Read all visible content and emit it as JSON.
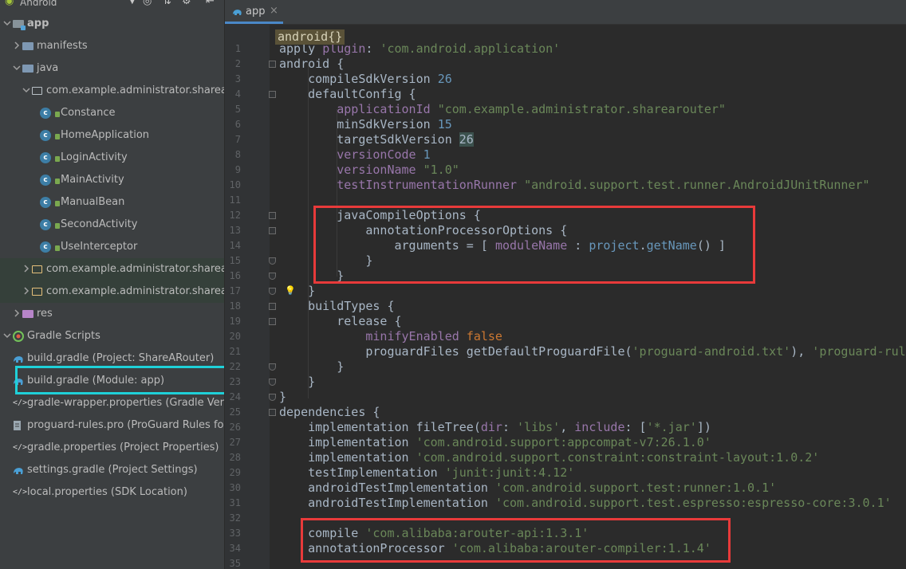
{
  "project_panel": {
    "view_selector": "Android",
    "tree": [
      {
        "label": "app",
        "depth": 0,
        "icon": "module-folder-icon",
        "expanded": true,
        "bold": true
      },
      {
        "label": "manifests",
        "depth": 1,
        "icon": "folder-icon",
        "expanded": false
      },
      {
        "label": "java",
        "depth": 1,
        "icon": "folder-icon",
        "expanded": true
      },
      {
        "label": "com.example.administrator.sharearouter",
        "depth": 2,
        "icon": "package-icon",
        "expanded": true
      },
      {
        "label": "Constance",
        "depth": 3,
        "icon": "class-icon"
      },
      {
        "label": "HomeApplication",
        "depth": 3,
        "icon": "class-icon"
      },
      {
        "label": "LoginActivity",
        "depth": 3,
        "icon": "class-icon"
      },
      {
        "label": "MainActivity",
        "depth": 3,
        "icon": "class-icon"
      },
      {
        "label": "ManualBean",
        "depth": 3,
        "icon": "class-icon"
      },
      {
        "label": "SecondActivity",
        "depth": 3,
        "icon": "class-icon"
      },
      {
        "label": "UseInterceptor",
        "depth": 3,
        "icon": "class-icon"
      },
      {
        "label": "com.example.administrator.sharearouter",
        "depth": 2,
        "icon": "test-package-icon",
        "expanded": false,
        "highlight": true
      },
      {
        "label": "com.example.administrator.sharearouter",
        "depth": 2,
        "icon": "test-package-icon",
        "expanded": false,
        "highlight": true
      },
      {
        "label": "res",
        "depth": 1,
        "icon": "res-folder-icon",
        "expanded": false
      },
      {
        "label": "Gradle Scripts",
        "depth": 0,
        "icon": "gradle-icon",
        "expanded": true
      },
      {
        "label": "build.gradle (Project: ShareARouter)",
        "depth": 1,
        "icon": "gradle-elephant-icon"
      },
      {
        "label": "build.gradle (Module: app)",
        "depth": 1,
        "icon": "gradle-elephant-icon",
        "selected": true
      },
      {
        "label": "gradle-wrapper.properties (Gradle Version)",
        "depth": 1,
        "icon": "properties-icon"
      },
      {
        "label": "proguard-rules.pro (ProGuard Rules for app)",
        "depth": 1,
        "icon": "file-icon"
      },
      {
        "label": "gradle.properties (Project Properties)",
        "depth": 1,
        "icon": "properties-icon"
      },
      {
        "label": "settings.gradle (Project Settings)",
        "depth": 1,
        "icon": "gradle-elephant-icon"
      },
      {
        "label": "local.properties (SDK Location)",
        "depth": 1,
        "icon": "properties-icon"
      }
    ]
  },
  "editor": {
    "tab_label": "app",
    "breadcrumb": "android{}",
    "colors": {
      "keyword": "#a9b7c6",
      "string": "#6a8759",
      "number": "#6897bb",
      "property": "#9876aa",
      "highlight_box": "#e83a3a",
      "selection_box": "#1fd0d8"
    },
    "lines": [
      {
        "n": "1",
        "segs": [
          [
            "kw",
            "apply "
          ],
          [
            "prop",
            "plugin"
          ],
          [
            "kw",
            ": "
          ],
          [
            "str",
            "'com.android.application'"
          ]
        ]
      },
      {
        "n": "2",
        "segs": [
          [
            "kw",
            "android {"
          ]
        ]
      },
      {
        "n": "3",
        "segs": [
          [
            "kw",
            "    compileSdkVersion "
          ],
          [
            "num",
            "26"
          ]
        ]
      },
      {
        "n": "4",
        "segs": [
          [
            "kw",
            "    defaultConfig {"
          ]
        ]
      },
      {
        "n": "5",
        "segs": [
          [
            "kw",
            "        "
          ],
          [
            "prop",
            "applicationId "
          ],
          [
            "str",
            "\"com.example.administrator.sharearouter\""
          ]
        ]
      },
      {
        "n": "6",
        "segs": [
          [
            "kw",
            "        minSdkVersion "
          ],
          [
            "num",
            "15"
          ]
        ]
      },
      {
        "n": "7",
        "segs": [
          [
            "kw",
            "        targetSdkVersion "
          ],
          [
            "hlnum",
            "26"
          ]
        ]
      },
      {
        "n": "8",
        "segs": [
          [
            "kw",
            "        "
          ],
          [
            "prop",
            "versionCode "
          ],
          [
            "num",
            "1"
          ]
        ]
      },
      {
        "n": "9",
        "segs": [
          [
            "kw",
            "        "
          ],
          [
            "prop",
            "versionName "
          ],
          [
            "str",
            "\"1.0\""
          ]
        ]
      },
      {
        "n": "10",
        "segs": [
          [
            "kw",
            "        "
          ],
          [
            "prop",
            "testInstrumentationRunner "
          ],
          [
            "str",
            "\"android.support.test.runner.AndroidJUnitRunner\""
          ]
        ]
      },
      {
        "n": "11",
        "segs": []
      },
      {
        "n": "12",
        "segs": [
          [
            "kw",
            "        javaCompileOptions {"
          ]
        ]
      },
      {
        "n": "13",
        "segs": [
          [
            "kw",
            "            annotationProcessorOptions {"
          ]
        ]
      },
      {
        "n": "14",
        "segs": [
          [
            "kw",
            "                arguments = [ "
          ],
          [
            "prop",
            "moduleName"
          ],
          [
            "kw",
            " : "
          ],
          [
            "fnm",
            "project"
          ],
          [
            "kw",
            "."
          ],
          [
            "fnm",
            "getName"
          ],
          [
            "kw",
            "() ]"
          ]
        ]
      },
      {
        "n": "15",
        "segs": [
          [
            "kw",
            "            }"
          ]
        ]
      },
      {
        "n": "16",
        "segs": [
          [
            "kw",
            "        }"
          ]
        ]
      },
      {
        "n": "17",
        "segs": [
          [
            "kw",
            "    }"
          ]
        ]
      },
      {
        "n": "18",
        "segs": [
          [
            "kw",
            "    buildTypes {"
          ]
        ]
      },
      {
        "n": "19",
        "segs": [
          [
            "kw",
            "        release {"
          ]
        ]
      },
      {
        "n": "20",
        "segs": [
          [
            "kw",
            "            "
          ],
          [
            "prop",
            "minifyEnabled "
          ],
          [
            "bool",
            "false"
          ]
        ]
      },
      {
        "n": "21",
        "segs": [
          [
            "kw",
            "            proguardFiles getDefaultProguardFile("
          ],
          [
            "str",
            "'proguard-android.txt'"
          ],
          [
            "kw",
            "), "
          ],
          [
            "str",
            "'proguard-rules.pro'"
          ]
        ]
      },
      {
        "n": "22",
        "segs": [
          [
            "kw",
            "        }"
          ]
        ]
      },
      {
        "n": "23",
        "segs": [
          [
            "kw",
            "    }"
          ]
        ]
      },
      {
        "n": "24",
        "segs": [
          [
            "kw",
            "}"
          ]
        ]
      },
      {
        "n": "25",
        "segs": [
          [
            "kw",
            "dependencies {"
          ]
        ]
      },
      {
        "n": "26",
        "segs": [
          [
            "kw",
            "    implementation fileTree("
          ],
          [
            "prop",
            "dir"
          ],
          [
            "kw",
            ": "
          ],
          [
            "str",
            "'libs'"
          ],
          [
            "kw",
            ", "
          ],
          [
            "prop",
            "include"
          ],
          [
            "kw",
            ": ["
          ],
          [
            "str",
            "'*.jar'"
          ],
          [
            "kw",
            "])"
          ]
        ]
      },
      {
        "n": "27",
        "segs": [
          [
            "kw",
            "    implementation "
          ],
          [
            "str",
            "'com.android.support:appcompat-v7:26.1.0'"
          ]
        ]
      },
      {
        "n": "28",
        "segs": [
          [
            "kw",
            "    implementation "
          ],
          [
            "str",
            "'com.android.support.constraint:constraint-layout:1.0.2'"
          ]
        ]
      },
      {
        "n": "29",
        "segs": [
          [
            "kw",
            "    testImplementation "
          ],
          [
            "str",
            "'junit:junit:4.12'"
          ]
        ]
      },
      {
        "n": "30",
        "segs": [
          [
            "kw",
            "    androidTestImplementation "
          ],
          [
            "str",
            "'com.android.support.test:runner:1.0.1'"
          ]
        ]
      },
      {
        "n": "31",
        "segs": [
          [
            "kw",
            "    androidTestImplementation "
          ],
          [
            "str",
            "'com.android.support.test.espresso:espresso-core:3.0.1'"
          ]
        ]
      },
      {
        "n": "32",
        "segs": []
      },
      {
        "n": "33",
        "segs": [
          [
            "kw",
            "    compile "
          ],
          [
            "str",
            "'com.alibaba:arouter-api:1.3.1'"
          ]
        ]
      },
      {
        "n": "34",
        "segs": [
          [
            "kw",
            "    annotationProcessor "
          ],
          [
            "str",
            "'com.alibaba:arouter-compiler:1.1.4'"
          ]
        ]
      },
      {
        "n": "35",
        "segs": []
      }
    ]
  }
}
